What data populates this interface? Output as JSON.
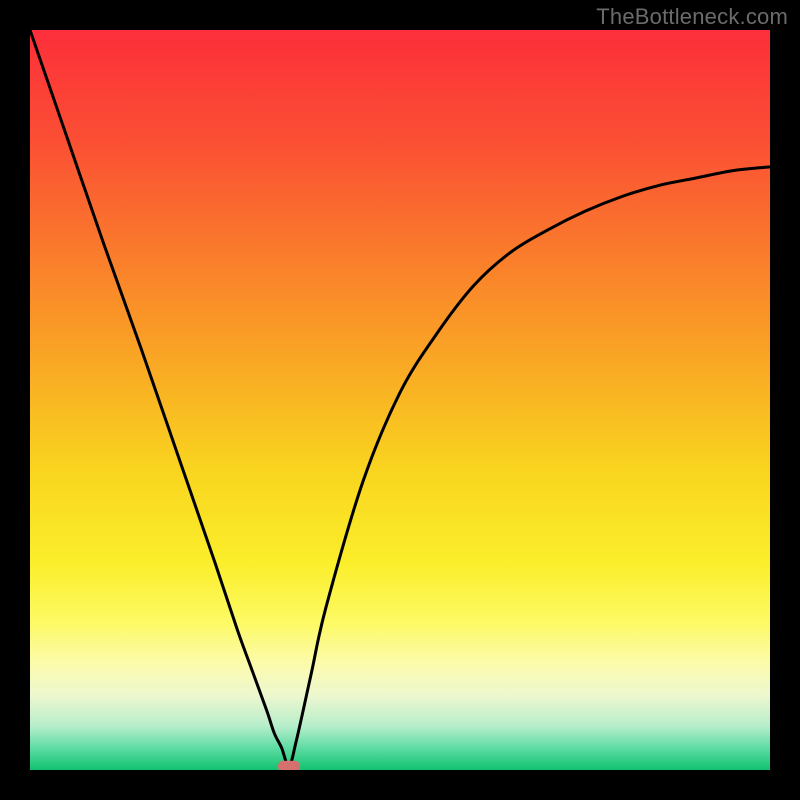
{
  "watermark": "TheBottleneck.com",
  "chart_data": {
    "type": "line",
    "title": "",
    "xlabel": "",
    "ylabel": "",
    "xlim": [
      0,
      100
    ],
    "ylim": [
      0,
      100
    ],
    "x": [
      0,
      5,
      10,
      15,
      20,
      25,
      28,
      30,
      32,
      33,
      34,
      35,
      36,
      38,
      40,
      45,
      50,
      55,
      60,
      65,
      70,
      75,
      80,
      85,
      90,
      95,
      100
    ],
    "values": [
      100,
      85.5,
      71,
      57,
      42.5,
      28,
      19,
      13.5,
      8,
      5,
      3,
      0.5,
      4,
      13,
      22,
      39,
      51,
      59,
      65.5,
      70,
      73,
      75.5,
      77.5,
      79,
      80,
      81,
      81.5
    ],
    "marker_x": 35,
    "marker_y": 0.5,
    "grid": false,
    "legend": false
  },
  "gradient": {
    "stops": [
      {
        "offset": 0.0,
        "color": "#fc2e3a"
      },
      {
        "offset": 0.15,
        "color": "#fb4f34"
      },
      {
        "offset": 0.3,
        "color": "#fa7b2c"
      },
      {
        "offset": 0.45,
        "color": "#f9a824"
      },
      {
        "offset": 0.6,
        "color": "#f9d61f"
      },
      {
        "offset": 0.72,
        "color": "#fbee2b"
      },
      {
        "offset": 0.8,
        "color": "#fdfa64"
      },
      {
        "offset": 0.86,
        "color": "#fbfbb0"
      },
      {
        "offset": 0.9,
        "color": "#ecf7cf"
      },
      {
        "offset": 0.94,
        "color": "#b8eecb"
      },
      {
        "offset": 0.97,
        "color": "#5fdca4"
      },
      {
        "offset": 1.0,
        "color": "#11c271"
      }
    ]
  },
  "marker_color": "#d4716f",
  "curve_color": "#000000"
}
